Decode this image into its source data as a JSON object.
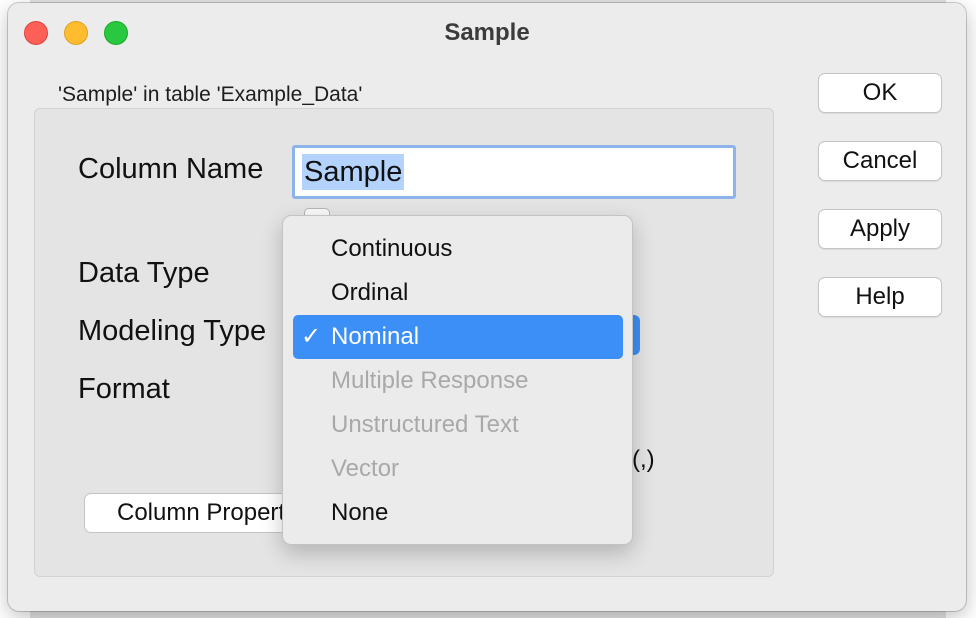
{
  "window": {
    "title": "Sample"
  },
  "subtitle": "'Sample' in table 'Example_Data'",
  "fields": {
    "column_name_label": "Column Name",
    "column_name_value": "Sample",
    "data_type_label": "Data Type",
    "modeling_type_label": "Modeling Type",
    "format_label": "Format",
    "separator_tail": "or (,)"
  },
  "buttons": {
    "ok": "OK",
    "cancel": "Cancel",
    "apply": "Apply",
    "help": "Help",
    "column_properties": "Column Properties"
  },
  "modeling_menu": {
    "selected": "Nominal",
    "items": [
      {
        "label": "Continuous",
        "enabled": true
      },
      {
        "label": "Ordinal",
        "enabled": true
      },
      {
        "label": "Nominal",
        "enabled": true
      },
      {
        "label": "Multiple Response",
        "enabled": false
      },
      {
        "label": "Unstructured Text",
        "enabled": false
      },
      {
        "label": "Vector",
        "enabled": false
      },
      {
        "label": "None",
        "enabled": true
      }
    ]
  },
  "colors": {
    "accent": "#3b8ff7",
    "selection": "#b3d3fd",
    "focus_ring": "#8db4ea"
  },
  "icons": {
    "checkmark": "checkmark-icon"
  }
}
